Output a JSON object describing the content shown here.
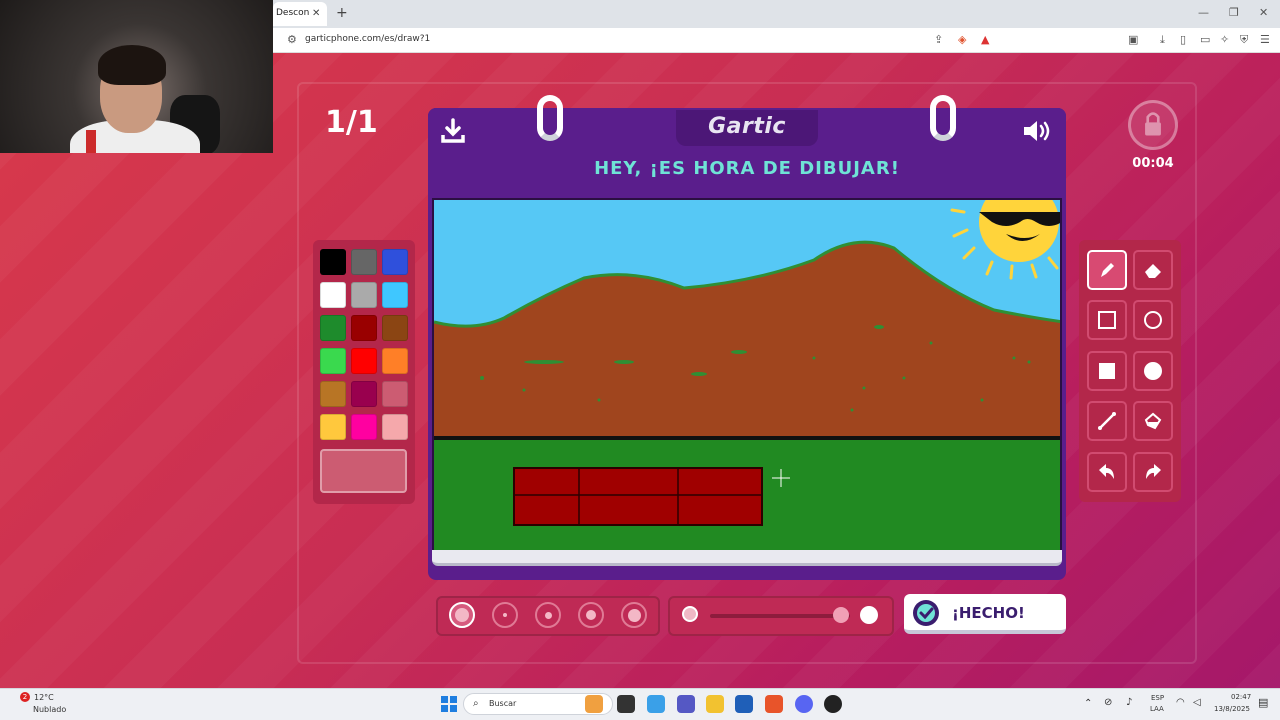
{
  "browser": {
    "tab_title": "Descon",
    "tab_close": "✕",
    "new_tab": "+",
    "url": "garticphone.com/es/draw?1",
    "minimize": "—",
    "restore": "❐",
    "close": "✕"
  },
  "game": {
    "round": "1/1",
    "logo": "Gartic",
    "headline": "HEY, ¡ES HORA DE DIBUJAR!",
    "timer": "00:04",
    "done_label": "¡HECHO!"
  },
  "palette": {
    "colors": [
      "#000000",
      "#666666",
      "#2f50dc",
      "#ffffff",
      "#aaaaaa",
      "#3fc7ff",
      "#1e8b2c",
      "#990000",
      "#8b4513",
      "#3ad94e",
      "#ff0000",
      "#ff7f27",
      "#b87525",
      "#99004e",
      "#cc5c72",
      "#ffc83d",
      "#ff00a0",
      "#f5a8ab"
    ],
    "current": "#cc5c72"
  },
  "tools": [
    "pencil-icon",
    "eraser-icon",
    "rectangle-outline-icon",
    "ellipse-outline-icon",
    "rectangle-filled-icon",
    "ellipse-filled-icon",
    "line-icon",
    "fill-bucket-icon",
    "undo-icon",
    "redo-icon"
  ],
  "brush_sizes": 5,
  "taskbar": {
    "weather_temp": "12°C",
    "weather_desc": "Nublado",
    "search_placeholder": "Buscar",
    "lang_1": "ESP",
    "lang_2": "LAA",
    "time": "02:47",
    "date": "13/8/2025",
    "notif_badge": "2"
  }
}
